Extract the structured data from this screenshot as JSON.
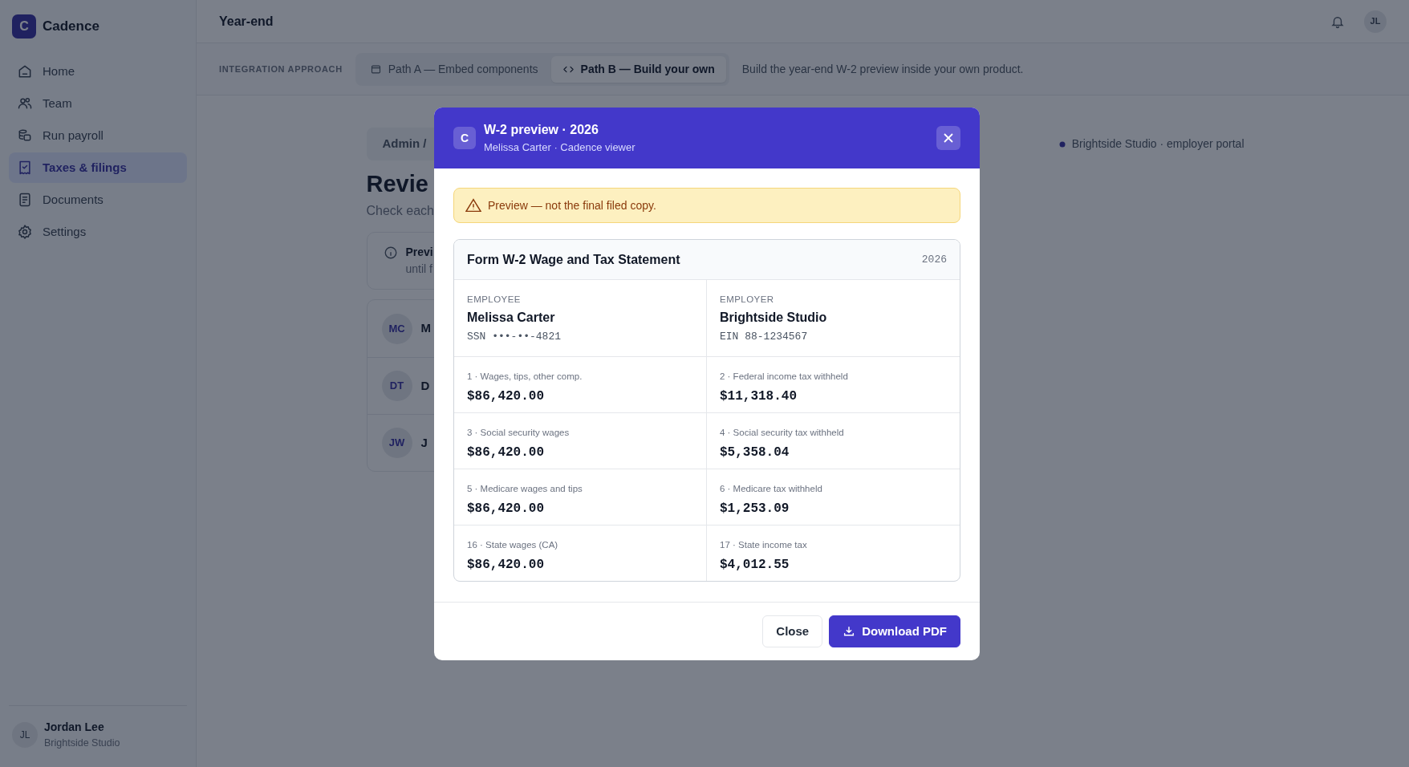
{
  "app": {
    "logo": "C",
    "name": "Cadence"
  },
  "sidebar": {
    "items": [
      {
        "label": "Home",
        "kind": "home",
        "selected": false
      },
      {
        "label": "Team",
        "kind": "team",
        "selected": false
      },
      {
        "label": "Run payroll",
        "kind": "payroll",
        "selected": false
      },
      {
        "label": "Taxes & filings",
        "kind": "taxes",
        "selected": true
      },
      {
        "label": "Documents",
        "kind": "documents",
        "selected": false
      },
      {
        "label": "Settings",
        "kind": "settings",
        "selected": false
      }
    ],
    "user": {
      "initials": "JL",
      "name": "Jordan Lee",
      "org": "Brightside Studio"
    }
  },
  "header": {
    "title": "Year-end",
    "avatar": "JL"
  },
  "integration": {
    "label": "INTEGRATION APPROACH",
    "options": [
      {
        "label": "Path A — Embed components",
        "kind": "window",
        "selected": false
      },
      {
        "label": "Path B — Build your own",
        "kind": "code",
        "selected": true
      }
    ],
    "description": "Build the year-end W-2 preview inside your own product."
  },
  "page": {
    "breadcrumb": "Admin /",
    "portal": "Brightside Studio · employer portal",
    "title": "Revie",
    "subtitle": "Check each",
    "notice": {
      "title": "Previ",
      "text": "until f"
    },
    "employees": [
      {
        "initials": "MC",
        "name": "M"
      },
      {
        "initials": "DT",
        "name": "D"
      },
      {
        "initials": "JW",
        "name": "J"
      }
    ]
  },
  "modal": {
    "logo": "C",
    "title": "W-2 preview · 2026",
    "subtitle": "Melissa Carter · Cadence viewer",
    "warning": "Preview — not the final filed copy.",
    "form": {
      "title": "Form W-2 Wage and Tax Statement",
      "year": "2026",
      "parties": [
        {
          "label": "EMPLOYEE",
          "name": "Melissa Carter",
          "id": "SSN •••-••-4821"
        },
        {
          "label": "EMPLOYER",
          "name": "Brightside Studio",
          "id": "EIN 88-1234567"
        }
      ],
      "boxes": [
        {
          "label": "1 · Wages, tips, other comp.",
          "amount": "$86,420.00"
        },
        {
          "label": "2 · Federal income tax withheld",
          "amount": "$11,318.40"
        },
        {
          "label": "3 · Social security wages",
          "amount": "$86,420.00"
        },
        {
          "label": "4 · Social security tax withheld",
          "amount": "$5,358.04"
        },
        {
          "label": "5 · Medicare wages and tips",
          "amount": "$86,420.00"
        },
        {
          "label": "6 · Medicare tax withheld",
          "amount": "$1,253.09"
        },
        {
          "label": "16 · State wages (CA)",
          "amount": "$86,420.00"
        },
        {
          "label": "17 · State income tax",
          "amount": "$4,012.55"
        }
      ]
    },
    "buttons": [
      {
        "label": "Close",
        "kind": "secondary"
      },
      {
        "label": "Download PDF",
        "kind": "primary"
      }
    ]
  }
}
